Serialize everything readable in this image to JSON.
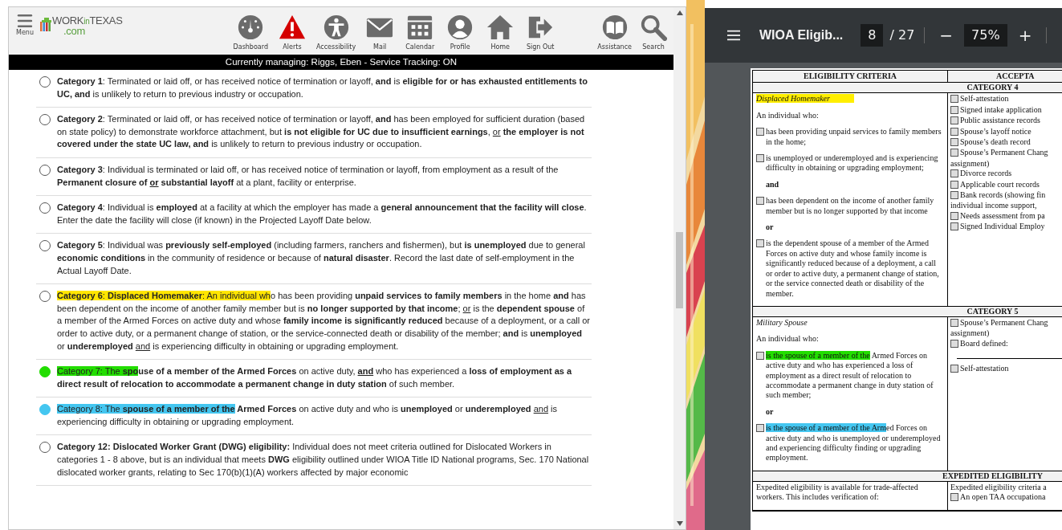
{
  "app": {
    "menu_label": "Menu",
    "logo": {
      "parts": [
        "WORK",
        "in",
        "TEXAS"
      ],
      "domain": ".com"
    },
    "nav": [
      {
        "label": "Dashboard"
      },
      {
        "label": "Alerts"
      },
      {
        "label": "Accessibility"
      },
      {
        "label": "Mail"
      },
      {
        "label": "Calendar"
      },
      {
        "label": "Profile"
      },
      {
        "label": "Home"
      },
      {
        "label": "Sign Out"
      }
    ],
    "tools": [
      {
        "label": "Assistance"
      },
      {
        "label": "Search"
      }
    ],
    "banner": "Currently managing: Riggs, Eben - Service Tracking: ON",
    "categories": [
      {
        "selected": false,
        "segments": [
          {
            "t": "Category 1",
            "b": true
          },
          {
            "t": ": Terminated or laid off, or has received notice of termination or layoff, "
          },
          {
            "t": "and",
            "b": true
          },
          {
            "t": " is "
          },
          {
            "t": "eligible for or has exhausted entitlements to UC, and",
            "b": true
          },
          {
            "t": " is unlikely to return to previous industry or occupation."
          }
        ]
      },
      {
        "selected": false,
        "segments": [
          {
            "t": "Category 2",
            "b": true
          },
          {
            "t": ": Terminated or laid off, or has received notice of termination or layoff, "
          },
          {
            "t": "and",
            "b": true
          },
          {
            "t": " has been employed for sufficient duration (based on state policy) to demonstrate workforce attachment, but "
          },
          {
            "t": "is not eligible for UC due to insufficient earnings",
            "b": true
          },
          {
            "t": ", "
          },
          {
            "t": "or",
            "u": true
          },
          {
            "t": " the employer is not covered under the state UC law, and",
            "b": true
          },
          {
            "t": " is unlikely to return to previous industry or occupation."
          }
        ]
      },
      {
        "selected": false,
        "segments": [
          {
            "t": "Category 3",
            "b": true
          },
          {
            "t": ": Individual is terminated or laid off, or has received notice of termination or layoff, from employment as a result of the "
          },
          {
            "t": "Permanent closure of ",
            "b": true
          },
          {
            "t": "or",
            "b": true,
            "u": true
          },
          {
            "t": " substantial layoff",
            "b": true
          },
          {
            "t": " at a plant, facility or enterprise."
          }
        ]
      },
      {
        "selected": false,
        "segments": [
          {
            "t": "Category 4",
            "b": true
          },
          {
            "t": ": Individual is "
          },
          {
            "t": "employed",
            "b": true
          },
          {
            "t": " at a facility at which the employer has made a "
          },
          {
            "t": "general announcement that the facility will close",
            "b": true
          },
          {
            "t": ". Enter the date the facility will close (if known) in the Projected Layoff Date below."
          }
        ]
      },
      {
        "selected": false,
        "segments": [
          {
            "t": "Category 5",
            "b": true
          },
          {
            "t": ": Individual was "
          },
          {
            "t": "previously self-employed",
            "b": true
          },
          {
            "t": " (including farmers, ranchers and fishermen), but "
          },
          {
            "t": "is unemployed",
            "b": true
          },
          {
            "t": " due to general "
          },
          {
            "t": "economic conditions",
            "b": true
          },
          {
            "t": " in the community of residence or because of "
          },
          {
            "t": "natural disaster",
            "b": true
          },
          {
            "t": ". Record the last date of self-employment in the Actual Layoff Date."
          }
        ]
      },
      {
        "selected": false,
        "segments": [
          {
            "t": "Category 6",
            "b": true,
            "color": "#ffe500"
          },
          {
            "t": ": ",
            "color": "#ffe500"
          },
          {
            "t": "Displaced Homemaker",
            "b": true,
            "color": "#ffe500"
          },
          {
            "t": ": An individual wh",
            "color": "#ffe500"
          },
          {
            "t": "o has been providing "
          },
          {
            "t": "unpaid services to family members",
            "b": true
          },
          {
            "t": " in the home "
          },
          {
            "t": "and",
            "b": true
          },
          {
            "t": " has been dependent on the income of another family member but is "
          },
          {
            "t": "no longer supported by that income",
            "b": true
          },
          {
            "t": "; "
          },
          {
            "t": "or",
            "u": true
          },
          {
            "t": " is the "
          },
          {
            "t": "dependent spouse",
            "b": true
          },
          {
            "t": " of a member of the Armed Forces on active duty and whose "
          },
          {
            "t": "family income is significantly reduced",
            "b": true
          },
          {
            "t": " because of a deployment, or a call or order to active duty, or a permanent change of station, or the service-connected death or disability of the member; "
          },
          {
            "t": "and",
            "b": true
          },
          {
            "t": " is "
          },
          {
            "t": "unemployed",
            "b": true
          },
          {
            "t": " or "
          },
          {
            "t": "underemployed ",
            "b": true
          },
          {
            "t": "and",
            "u": true
          },
          {
            "t": " is experiencing difficulty in obtaining or upgrading employment."
          }
        ]
      },
      {
        "selected": false,
        "radio_highlighted": true,
        "segments": [
          {
            "t": "Category 7: The ",
            "color": "#22dd00"
          },
          {
            "t": "spo",
            "b": true,
            "color": "#22dd00"
          },
          {
            "t": "use of a member of the Armed Forces",
            "b": true
          },
          {
            "t": " on active duty, "
          },
          {
            "t": "and",
            "b": true,
            "u": true
          },
          {
            "t": " who has experienced a "
          },
          {
            "t": "loss of employment as a direct result of relocation to accommodate a permanent change in duty station",
            "b": true
          },
          {
            "t": " of such member."
          }
        ]
      },
      {
        "selected": false,
        "radio_highlighted": true,
        "segments": [
          {
            "t": "Category 8: The ",
            "color": "#44c6f0"
          },
          {
            "t": "spouse of a member of the",
            "b": true,
            "color": "#44c6f0"
          },
          {
            "t": " Armed Forces",
            "b": true
          },
          {
            "t": " on active duty and who is "
          },
          {
            "t": "unemployed",
            "b": true
          },
          {
            "t": " or "
          },
          {
            "t": "underemployed ",
            "b": true
          },
          {
            "t": "and",
            "u": true
          },
          {
            "t": " is experiencing difficulty in obtaining or upgrading employment."
          }
        ]
      },
      {
        "selected": false,
        "segments": [
          {
            "t": "Category 12: Dislocated Worker Grant (DWG) eligibility:",
            "b": true
          },
          {
            "t": " Individual does not meet criteria outlined for Dislocated Workers in categories 1 - 8 above, but is an individual that meets "
          },
          {
            "t": "DWG",
            "b": true
          },
          {
            "t": " eligibility outlined under WIOA Title ID National programs, Sec. 170 National dislocated worker grants, relating to Sec 170(b)(1)(A) workers affected by major economic"
          }
        ]
      }
    ]
  },
  "pdf_viewer": {
    "title": "WIOA Eligib...",
    "page": "8",
    "page_total": "/ 27",
    "zoom_out": "−",
    "zoom": "75%",
    "zoom_in": "+",
    "columns": [
      "ELIGIBILITY CRITERIA",
      "ACCEPTA"
    ],
    "sections": [
      {
        "header": "CATEGORY 4",
        "left": [
          {
            "kind": "heading",
            "text": "Displaced Homemaker",
            "color": "#ffee00"
          },
          {
            "kind": "text",
            "text": "An individual who:"
          },
          {
            "kind": "check",
            "checked": false,
            "text": "has been providing unpaid services to family members in the home;"
          },
          {
            "kind": "check",
            "checked": false,
            "text": "is unemployed or underemployed and is experiencing difficulty in obtaining or upgrading employment;"
          },
          {
            "kind": "connector",
            "text": "and"
          },
          {
            "kind": "check",
            "checked": false,
            "text": "has been dependent on the income of another family member but is no longer supported by that income"
          },
          {
            "kind": "connector",
            "text": "or"
          },
          {
            "kind": "check",
            "checked": false,
            "text": "is the dependent spouse of a member of the Armed Forces on active duty and whose family income is significantly reduced because of a deployment, a call or order to active duty, a permanent change of station, or the service connected death or disability of the member."
          }
        ],
        "right": [
          {
            "kind": "check",
            "checked": false,
            "text": "Self-attestation"
          },
          {
            "kind": "check",
            "checked": false,
            "text": "Signed intake application"
          },
          {
            "kind": "check",
            "checked": false,
            "text": "Public assistance records"
          },
          {
            "kind": "check",
            "checked": false,
            "text": "Spouse’s layoff notice"
          },
          {
            "kind": "check",
            "checked": false,
            "text": "Spouse’s death record"
          },
          {
            "kind": "check",
            "checked": false,
            "text": "Spouse’s Permanent Chang"
          },
          {
            "kind": "text",
            "text": "assignment)"
          },
          {
            "kind": "check",
            "checked": false,
            "text": "Divorce records"
          },
          {
            "kind": "check",
            "checked": false,
            "text": "Applicable court records"
          },
          {
            "kind": "check",
            "checked": false,
            "text": "Bank records (showing fin"
          },
          {
            "kind": "text",
            "text": "individual income support,"
          },
          {
            "kind": "check",
            "checked": false,
            "text": "Needs assessment from pa"
          },
          {
            "kind": "check",
            "checked": false,
            "text": "Signed Individual Employ"
          }
        ]
      },
      {
        "header": "CATEGORY 5",
        "left": [
          {
            "kind": "heading",
            "text": "Military Spouse"
          },
          {
            "kind": "text",
            "text": "An individual who:"
          },
          {
            "kind": "check",
            "checked": false,
            "color": "#22dd00",
            "highlight_text": "is the spouse of a member of the",
            "text": " Armed Forces on active duty and who has experienced a loss of employment as a direct result of relocation to accommodate a permanent change in duty station of such member;"
          },
          {
            "kind": "connector",
            "text": "or"
          },
          {
            "kind": "check",
            "checked": false,
            "color": "#44c6f0",
            "highlight_text": "is the spouse of a member of the Arm",
            "text": "ed Forces on active duty and who is unemployed or underemployed and experiencing difficulty finding or upgrading employment."
          }
        ],
        "right": [
          {
            "kind": "check",
            "checked": false,
            "text": "Spouse’s Permanent Chang"
          },
          {
            "kind": "text",
            "text": "assignment)"
          },
          {
            "kind": "check",
            "checked": false,
            "text": "Board defined:"
          },
          {
            "kind": "blank"
          },
          {
            "kind": "check",
            "checked": false,
            "text": "Self-attestation"
          }
        ]
      },
      {
        "header": "EXPEDITED ELIGIBILITY",
        "left": [
          {
            "kind": "text",
            "text": "Expedited eligibility is available for trade-affected workers. This includes verification of:"
          }
        ],
        "right": [
          {
            "kind": "text",
            "text": "Expedited eligibility criteria a"
          },
          {
            "kind": "check",
            "checked": false,
            "text": "An open TAA occupationa"
          }
        ]
      }
    ]
  }
}
